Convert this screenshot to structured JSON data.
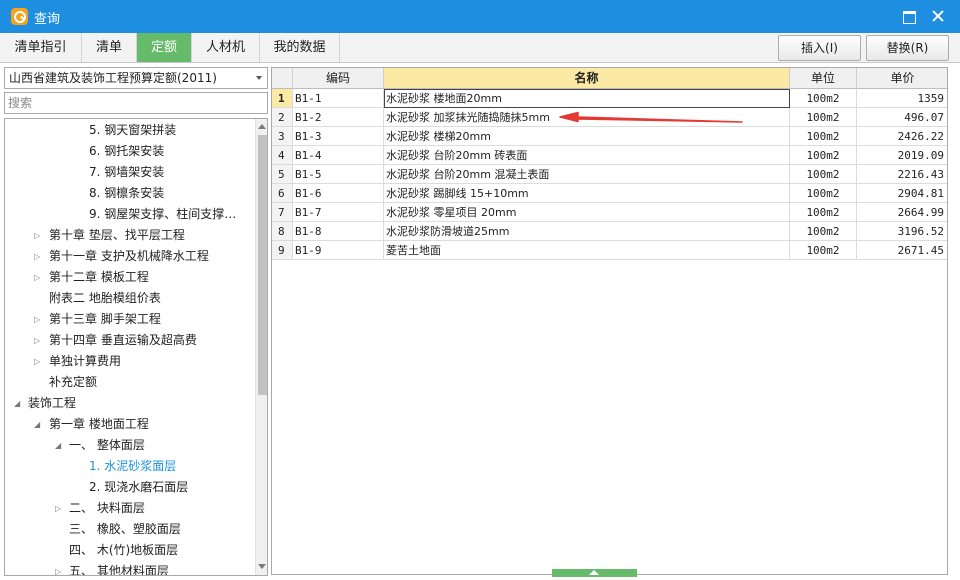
{
  "window": {
    "title": "查询"
  },
  "tabs": [
    {
      "label": "清单指引",
      "active": false
    },
    {
      "label": "清单",
      "active": false
    },
    {
      "label": "定额",
      "active": true
    },
    {
      "label": "人材机",
      "active": false
    },
    {
      "label": "我的数据",
      "active": false
    }
  ],
  "toolbar": {
    "insert_label": "插入(I)",
    "replace_label": "替换(R)"
  },
  "left": {
    "library": "山西省建筑及装饰工程预算定额(2011)",
    "search_placeholder": "搜索"
  },
  "tree": [
    {
      "label": "5. 钢天窗架拼装",
      "expander": ""
    },
    {
      "label": "6. 钢托架安装",
      "expander": ""
    },
    {
      "label": "7. 钢墙架安装",
      "expander": ""
    },
    {
      "label": "8. 钢檩条安装",
      "expander": ""
    },
    {
      "label": "9. 钢屋架支撑、柱间支撑…",
      "expander": ""
    },
    {
      "label": "第十章 垫层、找平层工程",
      "expander": "▷"
    },
    {
      "label": "第十一章 支护及机械降水工程",
      "expander": "▷"
    },
    {
      "label": "第十二章 模板工程",
      "expander": "▷"
    },
    {
      "label": "附表二 地胎模组价表",
      "expander": ""
    },
    {
      "label": "第十三章 脚手架工程",
      "expander": "▷"
    },
    {
      "label": "第十四章 垂直运输及超高费",
      "expander": "▷"
    },
    {
      "label": "单独计算费用",
      "expander": "▷"
    },
    {
      "label": "补充定额",
      "expander": ""
    },
    {
      "label": "装饰工程",
      "expander": "◢"
    },
    {
      "label": "第一章 楼地面工程",
      "expander": "◢"
    },
    {
      "label": "一、 整体面层",
      "expander": "◢"
    },
    {
      "label": "1. 水泥砂浆面层",
      "expander": "",
      "selected": true
    },
    {
      "label": "2. 现浇水磨石面层",
      "expander": ""
    },
    {
      "label": "二、 块料面层",
      "expander": "▷"
    },
    {
      "label": "三、 橡胶、塑胶面层",
      "expander": ""
    },
    {
      "label": "四、 木(竹)地板面层",
      "expander": ""
    },
    {
      "label": "五、 其他材料面层",
      "expander": "▷"
    }
  ],
  "grid": {
    "columns": {
      "code": "编码",
      "name": "名称",
      "unit": "单位",
      "price": "单价"
    },
    "rows": [
      {
        "idx": "1",
        "code": "B1-1",
        "name": "水泥砂浆 楼地面20mm",
        "unit": "100m2",
        "price": "1359"
      },
      {
        "idx": "2",
        "code": "B1-2",
        "name": "水泥砂浆 加浆抹光随捣随抹5mm",
        "unit": "100m2",
        "price": "496.07"
      },
      {
        "idx": "3",
        "code": "B1-3",
        "name": "水泥砂浆 楼梯20mm",
        "unit": "100m2",
        "price": "2426.22"
      },
      {
        "idx": "4",
        "code": "B1-4",
        "name": "水泥砂浆 台阶20mm 砖表面",
        "unit": "100m2",
        "price": "2019.09"
      },
      {
        "idx": "5",
        "code": "B1-5",
        "name": "水泥砂浆 台阶20mm 混凝土表面",
        "unit": "100m2",
        "price": "2216.43"
      },
      {
        "idx": "6",
        "code": "B1-6",
        "name": "水泥砂浆 踢脚线 15+10mm",
        "unit": "100m2",
        "price": "2904.81"
      },
      {
        "idx": "7",
        "code": "B1-7",
        "name": "水泥砂浆 零星项目 20mm",
        "unit": "100m2",
        "price": "2664.99"
      },
      {
        "idx": "8",
        "code": "B1-8",
        "name": "水泥砂浆防滑坡道25mm",
        "unit": "100m2",
        "price": "3196.52"
      },
      {
        "idx": "9",
        "code": "B1-9",
        "name": "菱苦土地面",
        "unit": "100m2",
        "price": "2671.45"
      }
    ]
  },
  "colors": {
    "titlebar": "#1e8fe0",
    "active_tab": "#66bb6a",
    "header_highlight": "#fbe9a4",
    "annotation": "#e53935"
  }
}
